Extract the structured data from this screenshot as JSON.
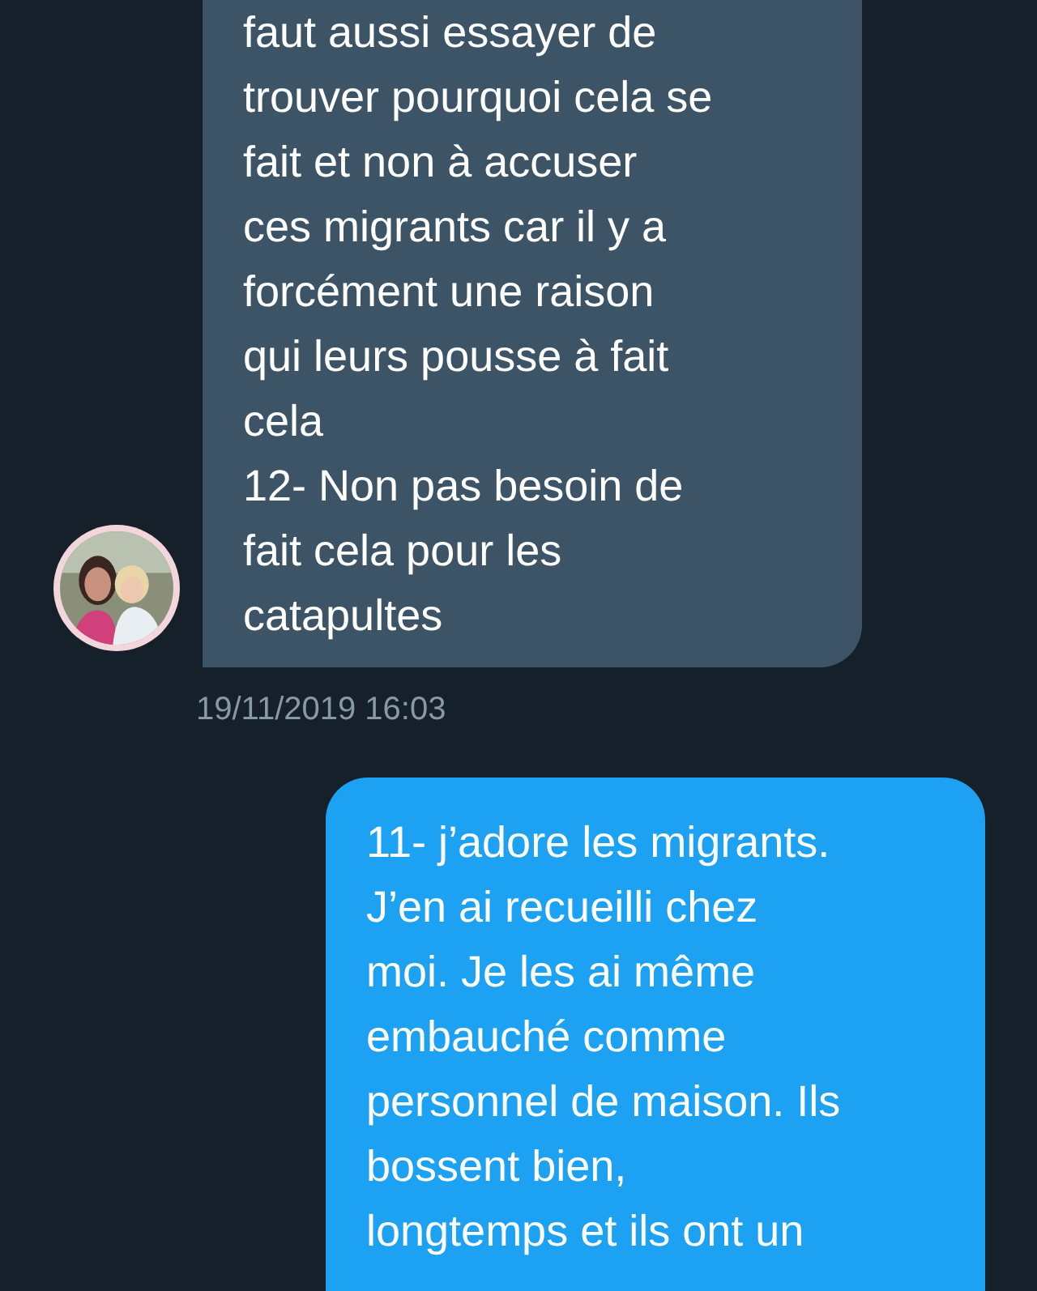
{
  "messages": [
    {
      "kind": "incoming",
      "text": "faut aussi essayer de\ntrouver pourquoi cela se\nfait et non à accuser\nces migrants car il y a\nforcément une raison\nqui leurs pousse à fait\ncela\n12- Non pas besoin de\nfait cela pour les\ncatapultes",
      "time": "19/11/2019 16:03"
    },
    {
      "kind": "outgoing",
      "text": "11- j’adore les migrants.\nJ’en ai recueilli chez\nmoi. Je les ai même\nembauché comme\npersonnel de maison. Ils\nbossent bien,\nlongtemps et ils ont un"
    }
  ]
}
